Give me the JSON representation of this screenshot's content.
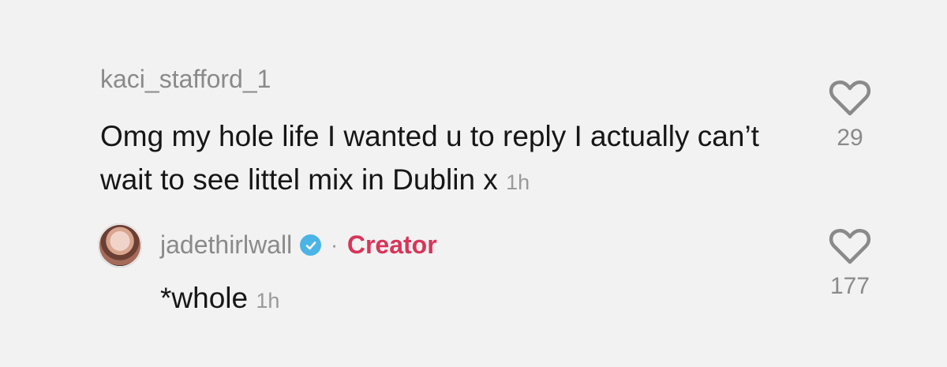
{
  "comment": {
    "username": "kaci_stafford_1",
    "text": "Omg my hole life I wanted u to reply I actually can’t wait to see littel mix in Dublin x",
    "time": "1h",
    "like_count": "29"
  },
  "reply": {
    "username": "jadethirlwall",
    "separator": "·",
    "creator_label": "Creator",
    "text": "*whole",
    "time": "1h",
    "like_count": "177"
  },
  "icons": {
    "like": "heart-outline-icon",
    "verified": "verified-badge-icon"
  },
  "colors": {
    "background": "#f2f2f2",
    "username": "#8a8a8a",
    "body_text": "#161616",
    "creator": "#d8355a",
    "verified": "#4bb3e6"
  }
}
